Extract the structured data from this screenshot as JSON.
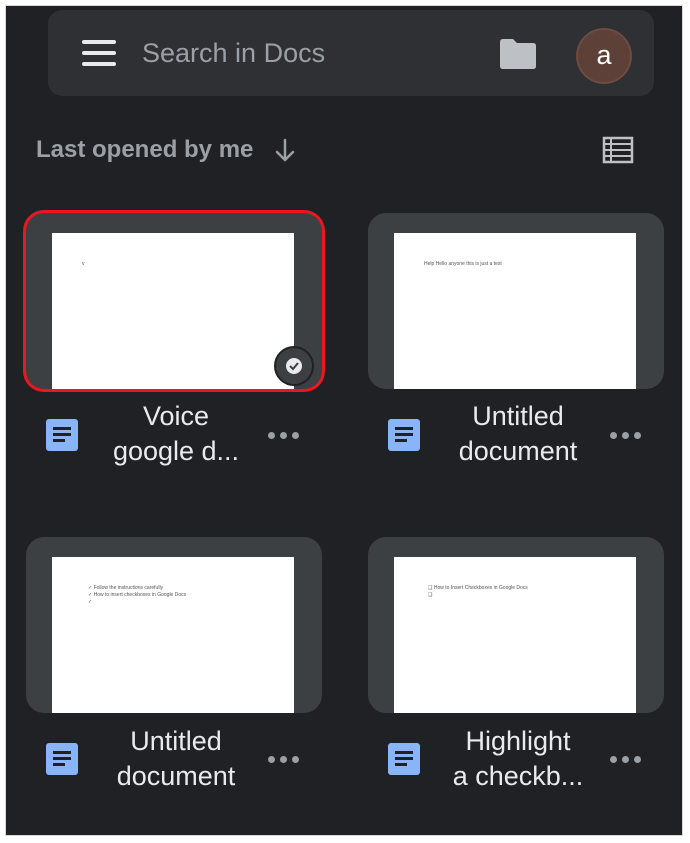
{
  "search": {
    "placeholder": "Search in Docs"
  },
  "avatar": {
    "initial": "a"
  },
  "sort": {
    "label": "Last opened by me"
  },
  "colors": {
    "accent_selected": "#e8181e",
    "doc_icon": "#8ab4f8",
    "background": "#202124"
  },
  "documents": [
    {
      "title_line1": "Voice",
      "title_line2": "google d...",
      "preview": [
        "v"
      ],
      "selected": true,
      "offline": true
    },
    {
      "title_line1": "Untitled",
      "title_line2": "document",
      "preview": [
        "Help Hello anyone this is just a test"
      ],
      "selected": false,
      "offline": false
    },
    {
      "title_line1": "Untitled",
      "title_line2": "document",
      "preview": [
        "✓ Follow the instructions carefully",
        "✓ How to insert checkboxes in Google Docs",
        "✓"
      ],
      "selected": false,
      "offline": false
    },
    {
      "title_line1": "Highlight",
      "title_line2": "a checkb...",
      "preview": [
        "❑ How to Insert Checkboxes in Google Docs",
        "❑"
      ],
      "selected": false,
      "offline": false
    }
  ]
}
